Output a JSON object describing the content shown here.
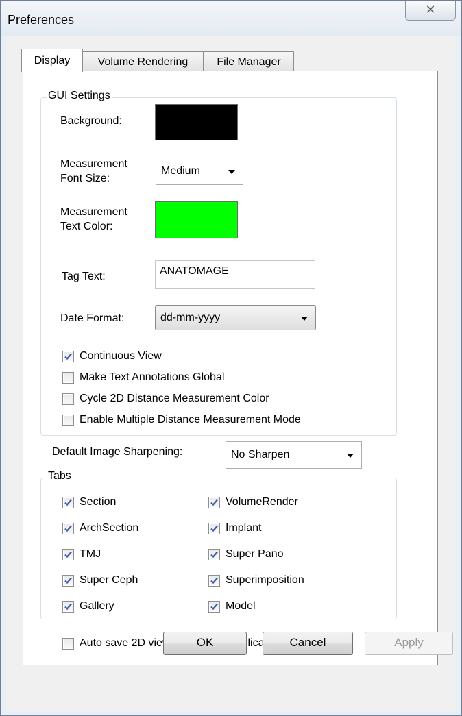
{
  "window": {
    "title": "Preferences",
    "close_glyph": "✕"
  },
  "tabs": [
    {
      "label": "Display",
      "active": true
    },
    {
      "label": "Volume Rendering",
      "active": false
    },
    {
      "label": "File Manager",
      "active": false
    }
  ],
  "gui_settings": {
    "legend": "GUI Settings",
    "background_label": "Background:",
    "background_color": "#000000",
    "font_size_label_line1": "Measurement",
    "font_size_label_line2": "Font Size:",
    "font_size_value": "Medium",
    "text_color_label_line1": "Measurement",
    "text_color_label_line2": "Text Color:",
    "text_color": "#00ff00",
    "tag_text_label": "Tag Text:",
    "tag_text_value": "ANATOMAGE",
    "date_format_label": "Date Format:",
    "date_format_value": "dd-mm-yyyy",
    "checkboxes": [
      {
        "label": "Continuous View",
        "checked": true
      },
      {
        "label": "Make Text Annotations Global",
        "checked": false
      },
      {
        "label": "Cycle 2D Distance Measurement Color",
        "checked": false
      },
      {
        "label": "Enable Multiple Distance Measurement Mode",
        "checked": false
      }
    ]
  },
  "sharpening": {
    "label": "Default Image Sharpening:",
    "value": "No Sharpen"
  },
  "tabs_group": {
    "legend": "Tabs",
    "items": [
      {
        "label": "Section",
        "checked": true
      },
      {
        "label": "VolumeRender",
        "checked": true
      },
      {
        "label": "ArchSection",
        "checked": true
      },
      {
        "label": "Implant",
        "checked": true
      },
      {
        "label": "TMJ",
        "checked": true
      },
      {
        "label": "Super Pano",
        "checked": true
      },
      {
        "label": "Super Ceph",
        "checked": true
      },
      {
        "label": "Superimposition",
        "checked": true
      },
      {
        "label": "Gallery",
        "checked": true
      },
      {
        "label": "Model",
        "checked": true
      }
    ]
  },
  "autosave": {
    "label": "Auto save 2D view settings on application exit",
    "checked": false
  },
  "buttons": {
    "ok": "OK",
    "cancel": "Cancel",
    "apply": "Apply"
  }
}
